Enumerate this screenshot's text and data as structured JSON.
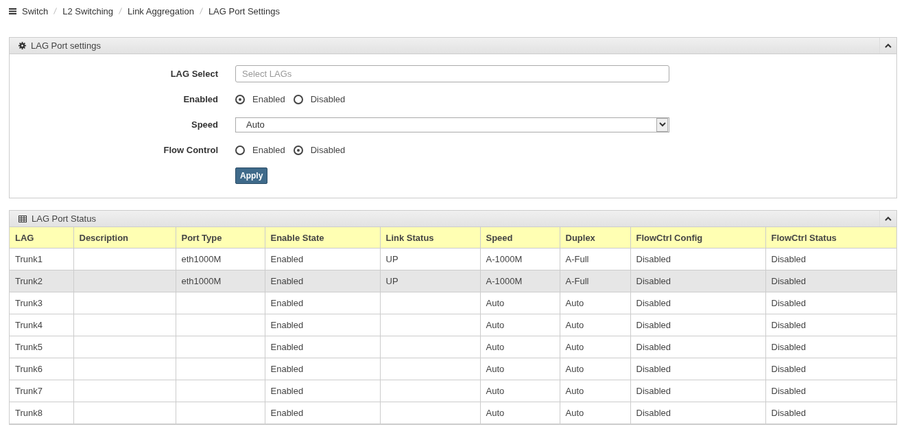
{
  "breadcrumb": [
    "Switch",
    "L2 Switching",
    "Link Aggregation",
    "LAG Port Settings"
  ],
  "settings_panel": {
    "title": "LAG Port settings",
    "expanded": true,
    "fields": [
      {
        "kind": "select-multi",
        "label": "LAG Select",
        "placeholder": "Select LAGs"
      },
      {
        "kind": "radio",
        "label": "Enabled",
        "options": [
          {
            "label": "Enabled",
            "selected": true
          },
          {
            "label": "Disabled",
            "selected": false
          }
        ]
      },
      {
        "kind": "dropdown",
        "label": "Speed",
        "value": "Auto"
      },
      {
        "kind": "radio",
        "label": "Flow Control",
        "options": [
          {
            "label": "Enabled",
            "selected": false
          },
          {
            "label": "Disabled",
            "selected": true
          }
        ]
      }
    ],
    "apply_button": "Apply"
  },
  "status_panel": {
    "title": "LAG Port Status",
    "expanded": true,
    "columns": [
      "LAG",
      "Description",
      "Port Type",
      "Enable State",
      "Link Status",
      "Speed",
      "Duplex",
      "FlowCtrl Config",
      "FlowCtrl Status"
    ],
    "rows": [
      {
        "highlighted": false,
        "cells": [
          "Trunk1",
          "",
          "eth1000M",
          "Enabled",
          "UP",
          "A-1000M",
          "A-Full",
          "Disabled",
          "Disabled"
        ]
      },
      {
        "highlighted": true,
        "cells": [
          "Trunk2",
          "",
          "eth1000M",
          "Enabled",
          "UP",
          "A-1000M",
          "A-Full",
          "Disabled",
          "Disabled"
        ]
      },
      {
        "highlighted": false,
        "cells": [
          "Trunk3",
          "",
          "",
          "Enabled",
          "",
          "Auto",
          "Auto",
          "Disabled",
          "Disabled"
        ]
      },
      {
        "highlighted": false,
        "cells": [
          "Trunk4",
          "",
          "",
          "Enabled",
          "",
          "Auto",
          "Auto",
          "Disabled",
          "Disabled"
        ]
      },
      {
        "highlighted": false,
        "cells": [
          "Trunk5",
          "",
          "",
          "Enabled",
          "",
          "Auto",
          "Auto",
          "Disabled",
          "Disabled"
        ]
      },
      {
        "highlighted": false,
        "cells": [
          "Trunk6",
          "",
          "",
          "Enabled",
          "",
          "Auto",
          "Auto",
          "Disabled",
          "Disabled"
        ]
      },
      {
        "highlighted": false,
        "cells": [
          "Trunk7",
          "",
          "",
          "Enabled",
          "",
          "Auto",
          "Auto",
          "Disabled",
          "Disabled"
        ]
      },
      {
        "highlighted": false,
        "cells": [
          "Trunk8",
          "",
          "",
          "Enabled",
          "",
          "Auto",
          "Auto",
          "Disabled",
          "Disabled"
        ]
      }
    ]
  }
}
